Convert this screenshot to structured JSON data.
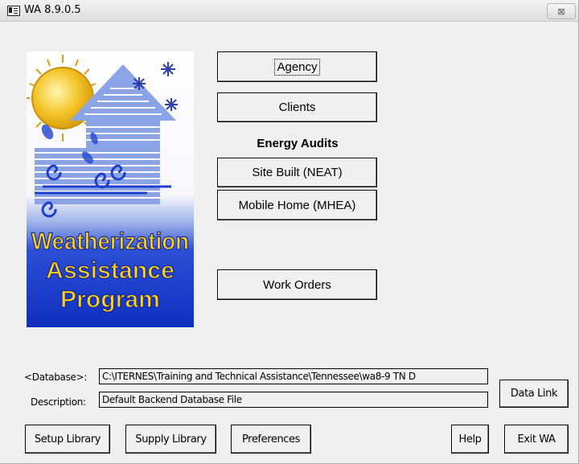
{
  "window": {
    "title": "WA 8.9.0.5",
    "close_glyph": "⊠"
  },
  "logo": {
    "line1": "Weatherization",
    "line2": "Assistance",
    "line3": "Program"
  },
  "main_buttons": {
    "agency": "Agency",
    "clients": "Clients",
    "energy_audits_heading": "Energy Audits",
    "site_built": "Site Built (NEAT)",
    "mobile_home": "Mobile Home (MHEA)",
    "work_orders": "Work Orders"
  },
  "database": {
    "label": "<Database>:",
    "value": "C:\\ITERNES\\Training and Technical Assistance\\Tennessee\\wa8-9 TN D",
    "description_label": "Description:",
    "description_value": "Default Backend Database File",
    "data_link_button": "Data Link"
  },
  "footer_buttons": {
    "setup_library": "Setup Library",
    "supply_library": "Supply Library",
    "preferences": "Preferences",
    "help": "Help",
    "exit": "Exit WA"
  },
  "colors": {
    "logo_sky": "#ffffff",
    "logo_blue": "#1133cc",
    "logo_yellow": "#ffd21a",
    "sun": "#f2c21b"
  }
}
